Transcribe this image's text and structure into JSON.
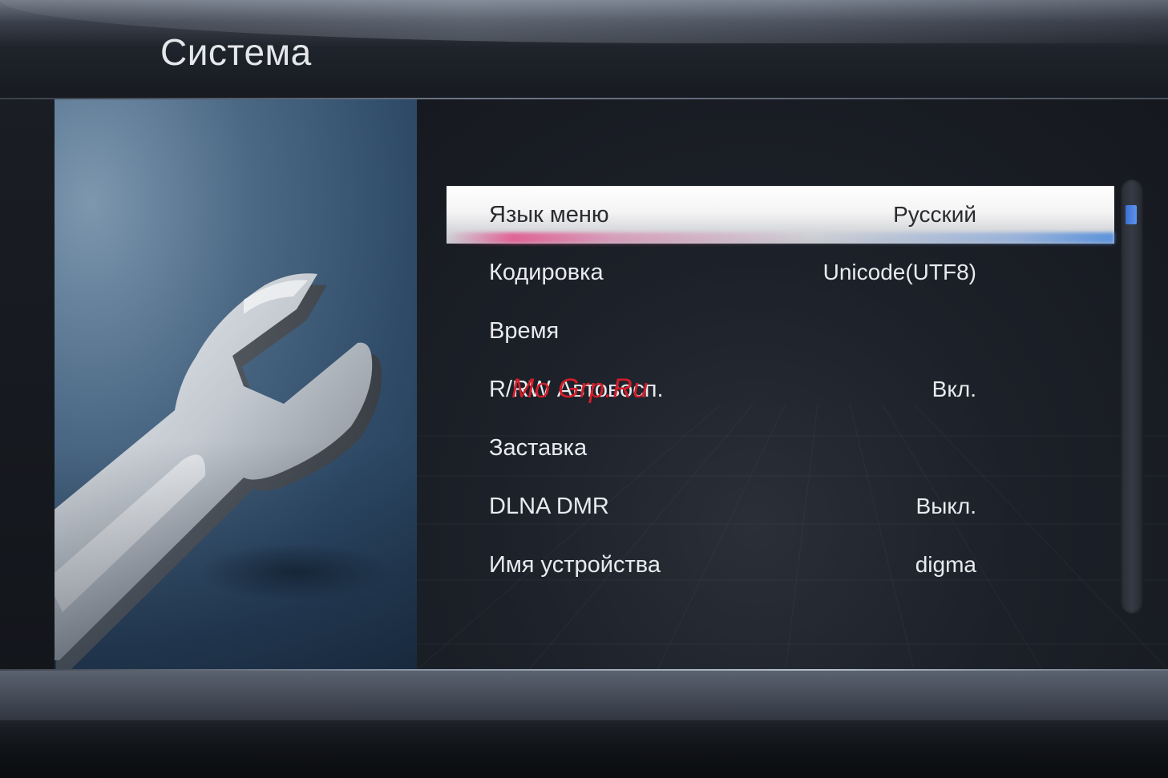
{
  "header": {
    "title": "Система"
  },
  "art": {
    "icon": "wrench-icon"
  },
  "menu": {
    "items": [
      {
        "label": "Язык меню",
        "value": "Русский",
        "selected": true
      },
      {
        "label": "Кодировка",
        "value": "Unicode(UTF8)",
        "selected": false
      },
      {
        "label": "Время",
        "value": "",
        "selected": false
      },
      {
        "label": "R/RW Автовосп.",
        "value": "Вкл.",
        "selected": false
      },
      {
        "label": "Заставка",
        "value": "",
        "selected": false
      },
      {
        "label": "DLNA DMR",
        "value": "Выкл.",
        "selected": false
      },
      {
        "label": "Имя устройства",
        "value": "digma",
        "selected": false
      }
    ]
  },
  "watermark": "Mo Grp.Ru",
  "scroll": {
    "position": 0
  },
  "colors": {
    "selection_highlight": "#f4f4f5",
    "scroll_thumb": "#4a80e0",
    "watermark": "#d41d2a",
    "text": "#e8eaee"
  }
}
